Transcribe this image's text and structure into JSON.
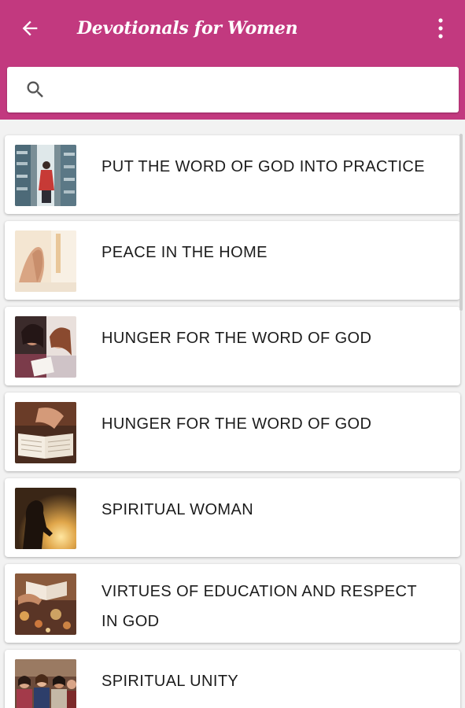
{
  "app_bar": {
    "title": "Devotionals for Women",
    "back_icon": "arrow-left-icon",
    "menu_icon": "more-vert-icon",
    "background_color": "#c2397f"
  },
  "search": {
    "icon": "search-icon",
    "value": "",
    "placeholder": ""
  },
  "devotionals": [
    {
      "title": "PUT THE WORD OF GOD INTO PRACTICE",
      "thumbnail": "library-woman-photo"
    },
    {
      "title": "PEACE IN THE HOME",
      "thumbnail": "praying-hands-photo"
    },
    {
      "title": "HUNGER FOR THE WORD OF GOD",
      "thumbnail": "women-reading-photo"
    },
    {
      "title": "HUNGER FOR THE WORD OF GOD",
      "thumbnail": "open-bible-photo"
    },
    {
      "title": "SPIRITUAL WOMAN",
      "thumbnail": "silhouette-sunset-photo"
    },
    {
      "title": "VIRTUES OF EDUCATION AND RESPECT IN GOD",
      "thumbnail": "book-bokeh-photo"
    },
    {
      "title": "SPIRITUAL UNITY",
      "thumbnail": "group-of-women-photo"
    }
  ]
}
